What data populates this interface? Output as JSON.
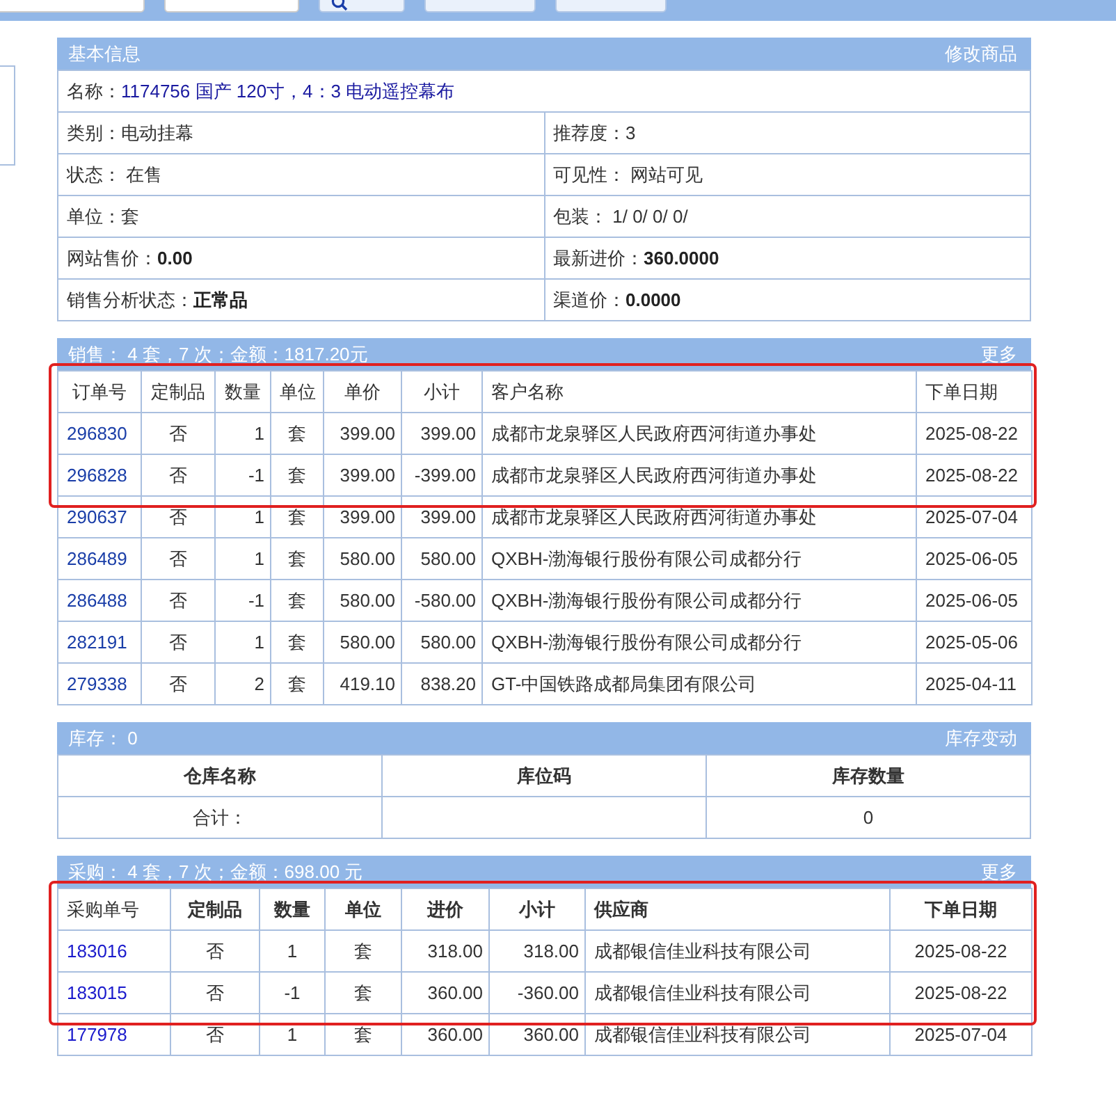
{
  "toolbar": {
    "fields": [
      {
        "kind": "input"
      },
      {
        "kind": "input"
      }
    ],
    "buttons": [
      {
        "kind": "search"
      },
      {
        "kind": "plain"
      },
      {
        "kind": "plain"
      }
    ]
  },
  "basic_info": {
    "title": "基本信息",
    "action": "修改商品",
    "name_label": "名称：",
    "name_value": "1174756 国产 120寸，4：3 电动遥控幕布",
    "fields": [
      {
        "label": "类别：",
        "value": "电动挂幕"
      },
      {
        "label": "推荐度：",
        "value": "3"
      },
      {
        "label": "状态： ",
        "value": "在售"
      },
      {
        "label": "可见性： ",
        "value": "网站可见"
      },
      {
        "label": "单位：",
        "value": "套"
      },
      {
        "label": "包装： ",
        "value": "1/ 0/ 0/ 0/"
      },
      {
        "label": "网站售价：",
        "value": "**0.00**"
      },
      {
        "label": "最新进价：",
        "value": "**360.0000**"
      },
      {
        "label": "销售分析状态：",
        "value": "**正常品**"
      },
      {
        "label": "渠道价：",
        "value": "**0.0000**"
      }
    ]
  },
  "sales": {
    "title": "销售： 4 套，7 次；金额：1817.20元",
    "more": "更多",
    "header_highlighted": true,
    "columns": [
      {
        "label": "订单号",
        "kind": "link"
      },
      {
        "label": "定制品",
        "kind": "center"
      },
      {
        "label": "数量",
        "kind": "number"
      },
      {
        "label": "单位",
        "kind": "center"
      },
      {
        "label": "单价",
        "kind": "number"
      },
      {
        "label": "小计",
        "kind": "number"
      },
      {
        "label": "客户名称",
        "kind": "text"
      },
      {
        "label": "下单日期",
        "kind": "text"
      }
    ],
    "rows": [
      {
        "highlighted": true,
        "cells": [
          "296830",
          "否",
          "1",
          "套",
          "399.00",
          "399.00",
          "成都市龙泉驿区人民政府西河街道办事处",
          "2025-08-22"
        ]
      },
      {
        "highlighted": true,
        "cells": [
          "296828",
          "否",
          "-1",
          "套",
          "399.00",
          "-399.00",
          "成都市龙泉驿区人民政府西河街道办事处",
          "2025-08-22"
        ]
      },
      {
        "highlighted": false,
        "cells": [
          "290637",
          "否",
          "1",
          "套",
          "399.00",
          "399.00",
          "成都市龙泉驿区人民政府西河街道办事处",
          "2025-07-04"
        ]
      },
      {
        "highlighted": false,
        "cells": [
          "286489",
          "否",
          "1",
          "套",
          "580.00",
          "580.00",
          "QXBH-渤海银行股份有限公司成都分行",
          "2025-06-05"
        ]
      },
      {
        "highlighted": false,
        "cells": [
          "286488",
          "否",
          "-1",
          "套",
          "580.00",
          "-580.00",
          "QXBH-渤海银行股份有限公司成都分行",
          "2025-06-05"
        ]
      },
      {
        "highlighted": false,
        "cells": [
          "282191",
          "否",
          "1",
          "套",
          "580.00",
          "580.00",
          "QXBH-渤海银行股份有限公司成都分行",
          "2025-05-06"
        ]
      },
      {
        "highlighted": false,
        "cells": [
          "279338",
          "否",
          "2",
          "套",
          "419.10",
          "838.20",
          "GT-中国铁路成都局集团有限公司",
          "2025-04-11"
        ]
      }
    ]
  },
  "stock": {
    "title": "库存： 0",
    "action": "库存变动",
    "columns": [
      "仓库名称",
      "库位码",
      "库存数量"
    ],
    "total": {
      "label": "合计：",
      "quantity": "0"
    }
  },
  "purchases": {
    "title": "采购： 4 套，7 次；金额：698.00 元",
    "more": "更多",
    "header_highlighted": true,
    "columns": [
      {
        "label": "采购单号",
        "kind": "link"
      },
      {
        "label": "定制品",
        "kind": "center"
      },
      {
        "label": "数量",
        "kind": "center"
      },
      {
        "label": "单位",
        "kind": "center"
      },
      {
        "label": "进价",
        "kind": "number"
      },
      {
        "label": "小计",
        "kind": "number"
      },
      {
        "label": "供应商",
        "kind": "text"
      },
      {
        "label": "下单日期",
        "kind": "center"
      }
    ],
    "rows": [
      {
        "highlighted": true,
        "cells": [
          "183016",
          "否",
          "1",
          "套",
          "318.00",
          "318.00",
          "成都银信佳业科技有限公司",
          "2025-08-22"
        ]
      },
      {
        "highlighted": true,
        "cells": [
          "183015",
          "否",
          "-1",
          "套",
          "360.00",
          "-360.00",
          "成都银信佳业科技有限公司",
          "2025-08-22"
        ]
      },
      {
        "highlighted": false,
        "cells": [
          "177978",
          "否",
          "1",
          "套",
          "360.00",
          "360.00",
          "成都银信佳业科技有限公司",
          "2025-07-04"
        ]
      }
    ]
  }
}
